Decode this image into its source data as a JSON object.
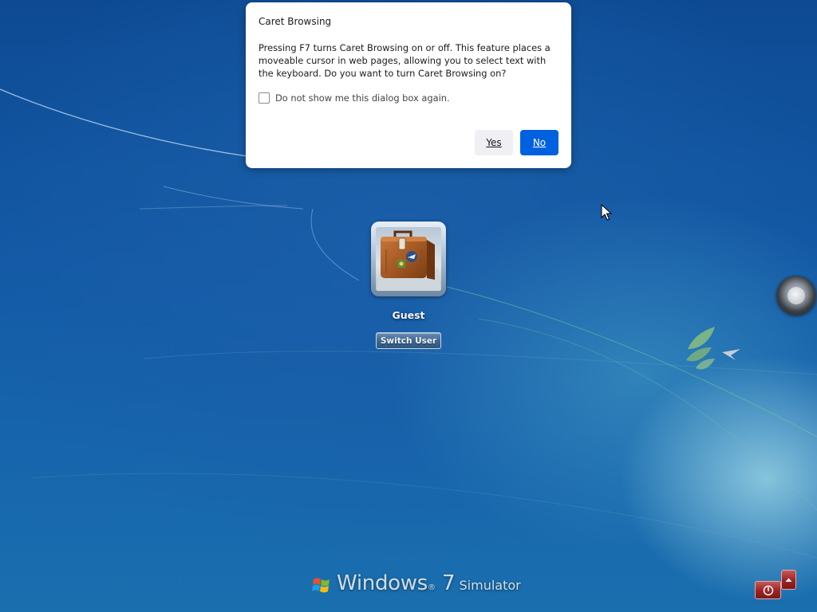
{
  "dialog": {
    "title": "Caret Browsing",
    "message": "Pressing F7 turns Caret Browsing on or off. This feature places a moveable cursor in web pages, allowing you to select text with the keyboard. Do you want to turn Caret Browsing on?",
    "checkbox_label": "Do not show me this dialog box again.",
    "checkbox_checked": false,
    "yes_label": "Yes",
    "no_label": "No"
  },
  "login": {
    "user_name": "Guest",
    "switch_user_label": "Switch User",
    "avatar_icon": "suitcase-icon"
  },
  "branding": {
    "windows": "Windows",
    "registered": "®",
    "version": "7",
    "edition": "Simulator"
  },
  "icons": {
    "ease_of_access": "ease-of-access-icon",
    "shutdown": "power-icon",
    "shutdown_options": "chevron-up-icon",
    "cursor": "mouse-pointer-icon"
  },
  "colors": {
    "primary_button": "#0061e0",
    "secondary_button": "#f0f0f4",
    "shutdown_red": "#9e2626",
    "desktop_blue": "#135aa6"
  }
}
